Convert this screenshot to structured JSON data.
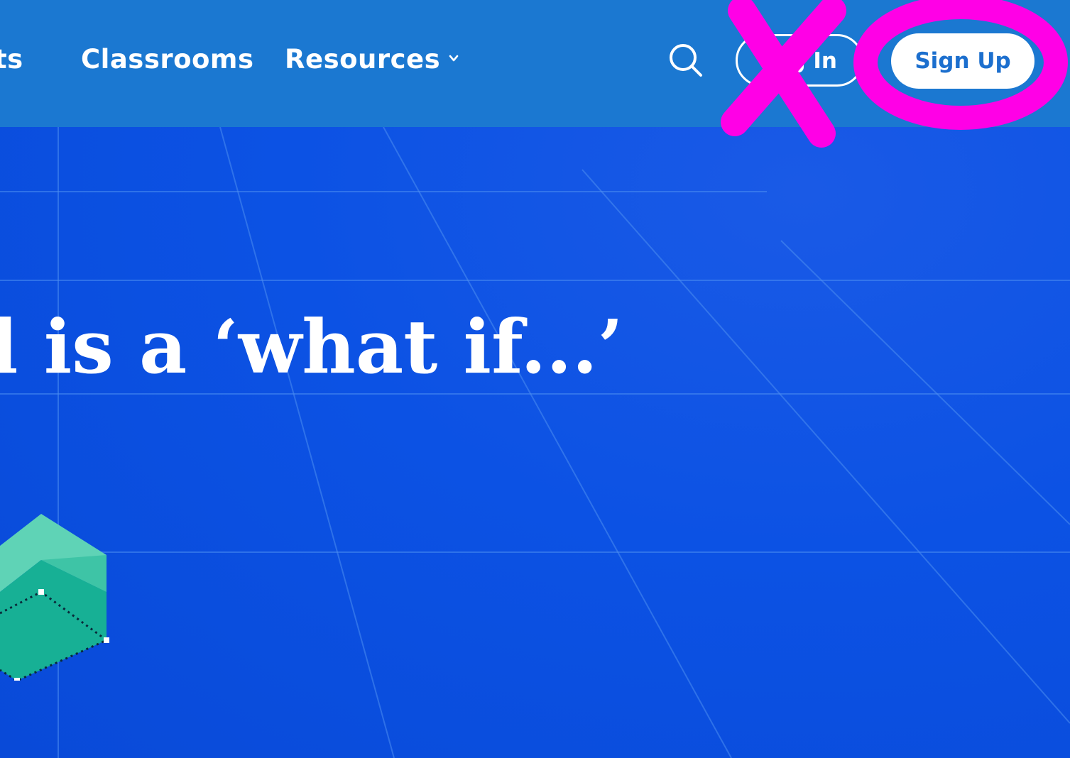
{
  "nav": {
    "items": [
      {
        "label": "ts"
      },
      {
        "label": "Classrooms"
      },
      {
        "label": "Resources"
      }
    ],
    "resources_icon": "chevron-down-icon",
    "search_icon": "search-icon",
    "login_label": "g In",
    "signup_label": "Sign Up"
  },
  "hero": {
    "headline": "l is a ‘what if...’",
    "illustration": "cube-3d-icon"
  },
  "annotations": {
    "cross_icon": "x-mark-annotation",
    "circle_icon": "circle-annotation",
    "color": "#ff00e6"
  },
  "colors": {
    "nav_bg": "#1b78d1",
    "hero_bg": "#0a4fe0",
    "button_text": "#1c6fce",
    "cube_top": "#5fd3b6",
    "cube_side": "#17b095"
  }
}
